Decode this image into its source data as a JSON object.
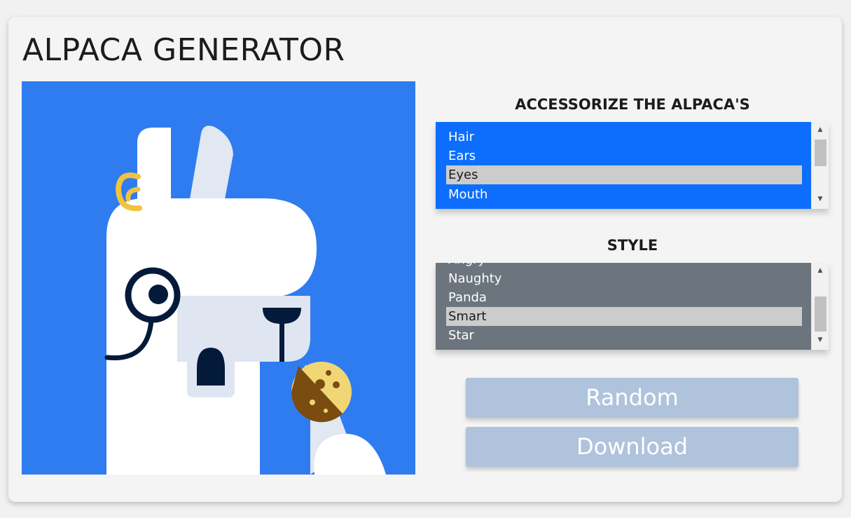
{
  "app": {
    "title": "ALPACA GENERATOR"
  },
  "accessorize": {
    "label": "ACCESSORIZE THE ALPACA'S",
    "background": "#0d6efd",
    "items": [
      "Hair",
      "Ears",
      "Eyes",
      "Mouth"
    ],
    "selected": "Eyes"
  },
  "style": {
    "label": "STYLE",
    "background": "#6c757d",
    "partial_item": "Angry",
    "items": [
      "Naughty",
      "Panda",
      "Smart",
      "Star"
    ],
    "selected": "Smart"
  },
  "actions": {
    "random_label": "Random",
    "download_label": "Download"
  },
  "colors": {
    "preview_bg": "#2f7cf0",
    "alpaca_white": "#ffffff",
    "alpaca_muzzle": "#dfe6f1",
    "dark_navy": "#041a3b",
    "ear_ring": "#f0c43c",
    "button_disabled": "#b0c3dc"
  },
  "icons": {
    "scroll_up": "triangle-up-icon",
    "scroll_down": "triangle-down-icon"
  }
}
